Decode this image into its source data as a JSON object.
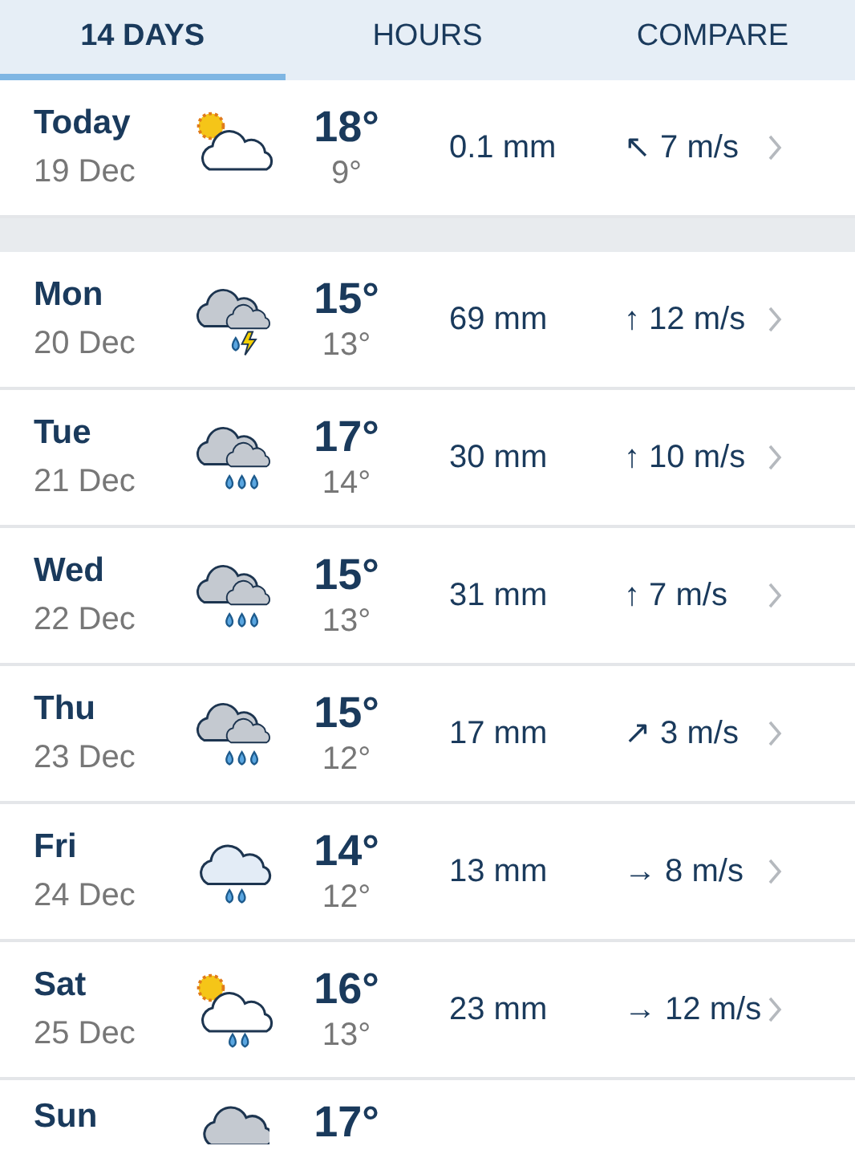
{
  "tabs": [
    {
      "label": "14 DAYS",
      "selected": true
    },
    {
      "label": "HOURS",
      "selected": false
    },
    {
      "label": "COMPARE",
      "selected": false
    }
  ],
  "days": [
    {
      "day": "Today",
      "date": "19 Dec",
      "kind": "sun-cloud",
      "high": "18°",
      "low": "9°",
      "precipitation": "0.1 mm",
      "wind": "↖ 7 m/s"
    },
    {
      "day": "Mon",
      "date": "20 Dec",
      "kind": "thunder-rain",
      "high": "15°",
      "low": "13°",
      "precipitation": "69 mm",
      "wind": "↑ 12 m/s"
    },
    {
      "day": "Tue",
      "date": "21 Dec",
      "kind": "heavy-rain",
      "high": "17°",
      "low": "14°",
      "precipitation": "30 mm",
      "wind": "↑ 10 m/s"
    },
    {
      "day": "Wed",
      "date": "22 Dec",
      "kind": "heavy-rain",
      "high": "15°",
      "low": "13°",
      "precipitation": "31 mm",
      "wind": "↑ 7 m/s"
    },
    {
      "day": "Thu",
      "date": "23 Dec",
      "kind": "heavy-rain",
      "high": "15°",
      "low": "12°",
      "precipitation": "17 mm",
      "wind": "↗ 3 m/s"
    },
    {
      "day": "Fri",
      "date": "24 Dec",
      "kind": "rain",
      "high": "14°",
      "low": "12°",
      "precipitation": "13 mm",
      "wind": "→ 8 m/s"
    },
    {
      "day": "Sat",
      "date": "25 Dec",
      "kind": "sun-rain",
      "high": "16°",
      "low": "13°",
      "precipitation": "23 mm",
      "wind": "→ 12 m/s"
    },
    {
      "day": "Sun",
      "kind": "cloud",
      "high": "17°"
    }
  ]
}
